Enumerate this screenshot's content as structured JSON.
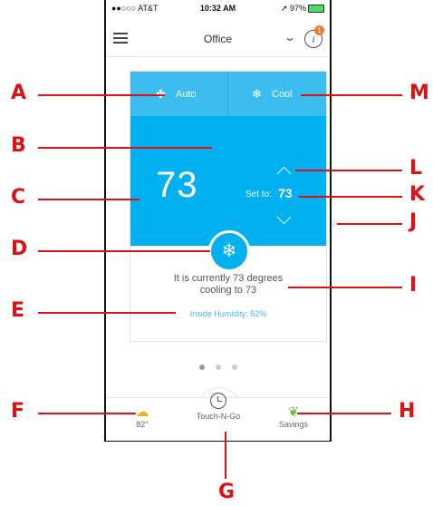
{
  "status_bar": {
    "carrier": "●●○○○ AT&T",
    "time": "10:32 AM",
    "battery": "➚ 97%"
  },
  "nav": {
    "location": "Office",
    "info_badge": "1",
    "info_glyph": "i"
  },
  "modes": {
    "fan_label": "Auto",
    "system_label": "Cool"
  },
  "thermostat": {
    "current_temp": "73",
    "set_to_label": "Set to:",
    "setpoint": "73",
    "status_line1": "It is currently 73 degrees",
    "status_line2": "cooling to 73",
    "humidity": "Inside Humidity: 52%"
  },
  "pager": {
    "count": 3,
    "active": 0
  },
  "bottom_nav": {
    "weather_label": "82°",
    "touch_label": "Touch-N-Go",
    "savings_label": "Savings"
  },
  "callouts": {
    "a": "A",
    "b": "B",
    "c": "C",
    "d": "D",
    "e": "E",
    "f": "F",
    "g": "G",
    "h": "H",
    "i": "I",
    "j": "J",
    "k": "K",
    "l": "L",
    "m": "M"
  },
  "colors": {
    "accent": "#00b0f0",
    "callout": "#dd1111",
    "badge": "#f07b2b"
  }
}
